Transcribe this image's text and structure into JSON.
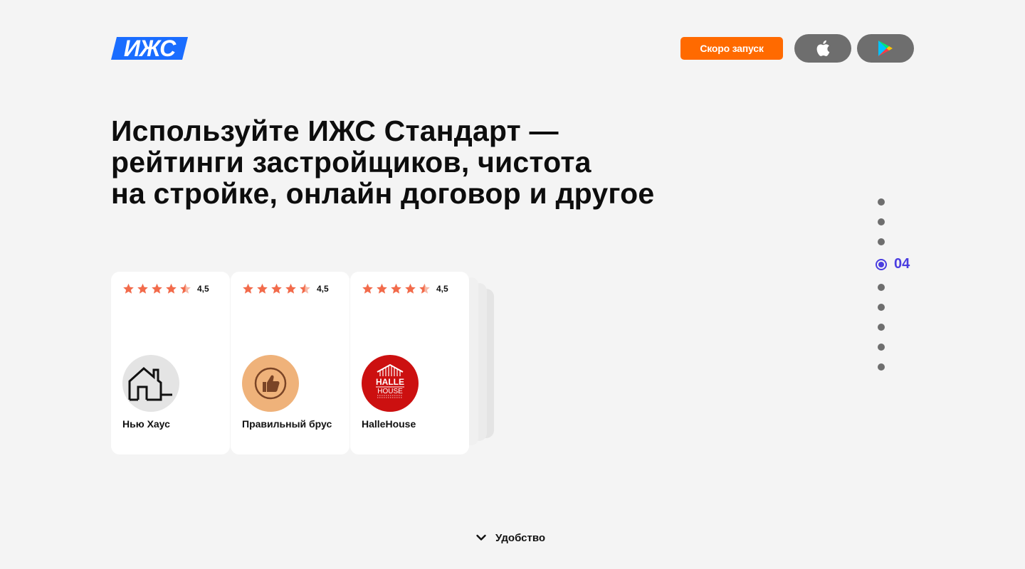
{
  "header": {
    "logo_text": "ИЖС",
    "launch_button": "Скоро запуск",
    "app_store_icon": "apple-icon",
    "google_play_icon": "google-play-icon"
  },
  "headline": {
    "lines": [
      "Используйте ИЖС Стандарт —",
      "рейтинги застройщиков, чистота",
      "на стройке, онлайн договор и другое"
    ]
  },
  "builders": [
    {
      "name": "Нью Хаус",
      "rating": "4,5",
      "rating_value": 4.5,
      "logo_icon": "house-outline-icon"
    },
    {
      "name": "Правильный брус",
      "rating": "4,5",
      "rating_value": 4.5,
      "logo_icon": "thumbs-up-icon"
    },
    {
      "name": "HalleHouse",
      "rating": "4,5",
      "rating_value": 4.5,
      "logo_icon": "halle-house-logo",
      "logo_text_top": "HALLE",
      "logo_text_bottom": "HOUSE"
    }
  ],
  "pager": {
    "total": 9,
    "active_index": 4,
    "active_label": "04"
  },
  "scroll_hint": {
    "label": "Удобство",
    "icon": "chevron-down-icon"
  },
  "colors": {
    "background": "#f4f4f4",
    "brand_blue": "#1a6dff",
    "launch_orange": "#ff6a00",
    "star": "#f26b4b",
    "pager_active": "#4a3de0",
    "store_button": "#6e6e6e"
  }
}
